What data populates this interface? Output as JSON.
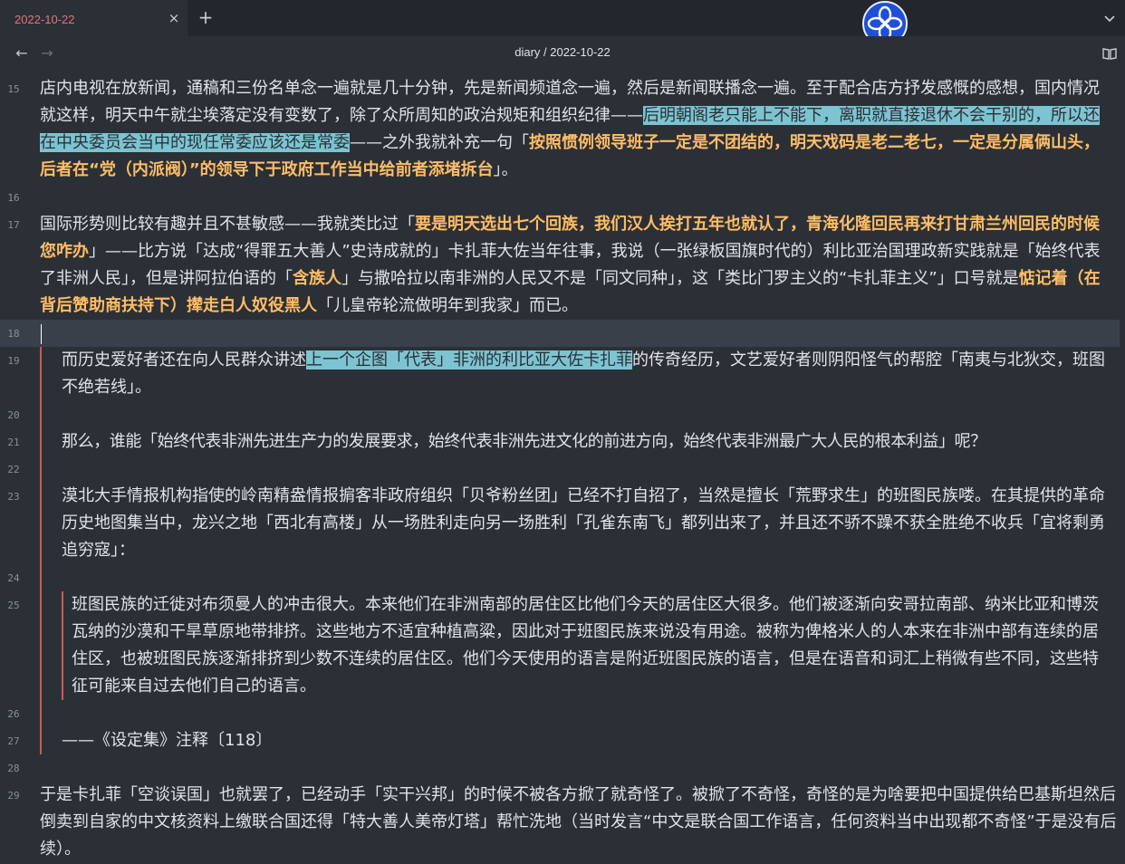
{
  "tab": {
    "title": "2022-10-22",
    "close_icon": "×",
    "new_icon": "+"
  },
  "header": {
    "back_icon": "←",
    "forward_icon": "→",
    "breadcrumb": "diary / 2022-10-22"
  },
  "lines": {
    "l15": {
      "num": "15",
      "t1": "店内电视在放新闻，通稿和三份名单念一遍就是几十分钟，先是新闻频道念一遍，然后是新闻联播念一遍。至于配合店方抒发感慨的感想，国内情况就这样，明天中午就尘埃落定没有变数了，除了众所周知的政治规矩和组织纪律——",
      "t2": "后明朝阁老只能上不能下，离职就直接退休不会干别的，所以还在中央委员会当中的现任常委应该还是常委",
      "t3": "——之外我就补充一句「",
      "t4": "按照惯例领导班子一定是不团结的，明天戏码是老二老七，一定是分属俩山头，后者在“党（内派阀）”的领导下于政府工作当中给前者添堵拆台",
      "t5": "」。"
    },
    "l16": {
      "num": "16"
    },
    "l17": {
      "num": "17",
      "t1": "国际形势则比较有趣并且不甚敏感——我就类比过「",
      "t2": "要是明天选出七个回族，我们汉人挨打五年也就认了，青海化隆回民再来打甘肃兰州回民的时候您咋办",
      "t3": "」——比方说「达成“得罪五大善人”史诗成就的」卡扎菲大佐当年往事，我说（一张绿板国旗时代的）利比亚治国理政新实践就是「始终代表了非洲人民」，但是讲阿拉伯语的「",
      "t4": "含族人",
      "t5": "」与撒哈拉以南非洲的人民又不是「同文同种」，这「类比门罗主义的“卡扎菲主义”」口号就是",
      "t6": "惦记着（在背后赞助商扶持下）撵走白人奴役黑人",
      "t7": "「儿皇帝轮流做明年到我家」而已。"
    },
    "l18": {
      "num": "18"
    },
    "l19": {
      "num": "19",
      "t1": "而历史爱好者还在向人民群众讲述",
      "t2": "上一个企图「代表」非洲的利比亚大佐卡扎菲",
      "t3": "的传奇经历，文艺爱好者则阴阳怪气的帮腔「南夷与北狄交，班图不绝若线」。"
    },
    "l20": {
      "num": "20"
    },
    "l21": {
      "num": "21",
      "t1": "那么，谁能「始终代表非洲先进生产力的发展要求，始终代表非洲先进文化的前进方向，始终代表非洲最广大人民的根本利益」呢？"
    },
    "l22": {
      "num": "22"
    },
    "l23": {
      "num": "23",
      "t1": "漠北大手情报机构指使的岭南精盎情报掮客非政府组织「贝爷粉丝团」已经不打自招了，当然是擅长「荒野求生」的班图民族喽。在其提供的革命历史地图集当中，龙兴之地「西北有高楼」从一场胜利走向另一场胜利「孔雀东南飞」都列出来了，并且还不骄不躁不获全胜绝不收兵「宜将剩勇追穷寇」："
    },
    "l24": {
      "num": "24"
    },
    "l25": {
      "num": "25",
      "t1": "班图民族的迁徙对布须曼人的冲击很大。本来他们在非洲南部的居住区比他们今天的居住区大很多。他们被逐渐向安哥拉南部、纳米比亚和博茨瓦纳的沙漠和干旱草原地带排挤。这些地方不适宜种植高粱，因此对于班图民族来说没有用途。被称为俾格米人的人本来在非洲中部有连续的居住区，也被班图民族逐渐排挤到少数不连续的居住区。他们今天使用的语言是附近班图民族的语言，但是在语音和词汇上稍微有些不同，这些特征可能来自过去他们自己的语言。"
    },
    "l26": {
      "num": "26"
    },
    "l27": {
      "num": "27",
      "t1": "——《设定集》注释〔118〕"
    },
    "l28": {
      "num": "28"
    },
    "l29": {
      "num": "29",
      "t1": "于是卡扎菲「空谈误国」也就罢了，已经动手「实干兴邦」的时候不被各方掀了就奇怪了。被掀了不奇怪，奇怪的是为啥要把中国提供给巴基斯坦然后倒卖到自家的中文核资料上缴联合国还得「特大善人美帝灯塔」帮忙洗地（当时发言“中文是联合国工作语言，任何资料当中出现都不奇怪”于是没有后续）。"
    }
  },
  "colors": {
    "accent_tab": "#e57373",
    "highlight": "#7cc4d2",
    "bold_text": "#ffbd66",
    "quote_bar": "#c95a5a"
  }
}
